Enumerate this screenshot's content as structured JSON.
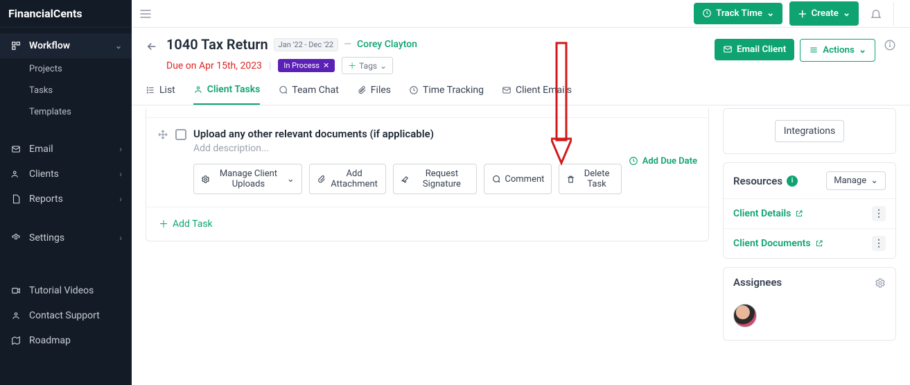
{
  "brand": "FinancialCents",
  "sidebar": {
    "workflow": {
      "label": "Workflow",
      "items": [
        "Projects",
        "Tasks",
        "Templates"
      ]
    },
    "items": [
      {
        "label": "Email"
      },
      {
        "label": "Clients"
      },
      {
        "label": "Reports"
      },
      {
        "label": "Settings"
      }
    ],
    "footer": [
      "Tutorial Videos",
      "Contact Support",
      "Roadmap"
    ]
  },
  "topbar": {
    "track": "Track Time",
    "create": "Create"
  },
  "header": {
    "title": "1040 Tax Return",
    "date_range": "Jan '22 - Dec '22",
    "dash": "—",
    "client": "Corey Clayton",
    "due": "Due on Apr 15th, 2023",
    "status": "In Process",
    "tags": "Tags",
    "email_btn": "Email Client",
    "actions_btn": "Actions"
  },
  "tabs": [
    {
      "label": "List"
    },
    {
      "label": "Client Tasks"
    },
    {
      "label": "Team Chat"
    },
    {
      "label": "Files"
    },
    {
      "label": "Time Tracking"
    },
    {
      "label": "Client Emails"
    }
  ],
  "task": {
    "title": "Upload any other relevant documents (if applicable)",
    "desc_placeholder": "Add description...",
    "add_due": "Add Due Date",
    "buttons": {
      "manage": "Manage Client Uploads",
      "attach": "Add Attachment",
      "signature": "Request Signature",
      "comment": "Comment",
      "delete": "Delete Task"
    },
    "add_task": "Add Task"
  },
  "side": {
    "integrations": "Integrations",
    "resources_title": "Resources",
    "manage": "Manage",
    "links": [
      "Client Details",
      "Client Documents"
    ],
    "assignees_title": "Assignees"
  }
}
